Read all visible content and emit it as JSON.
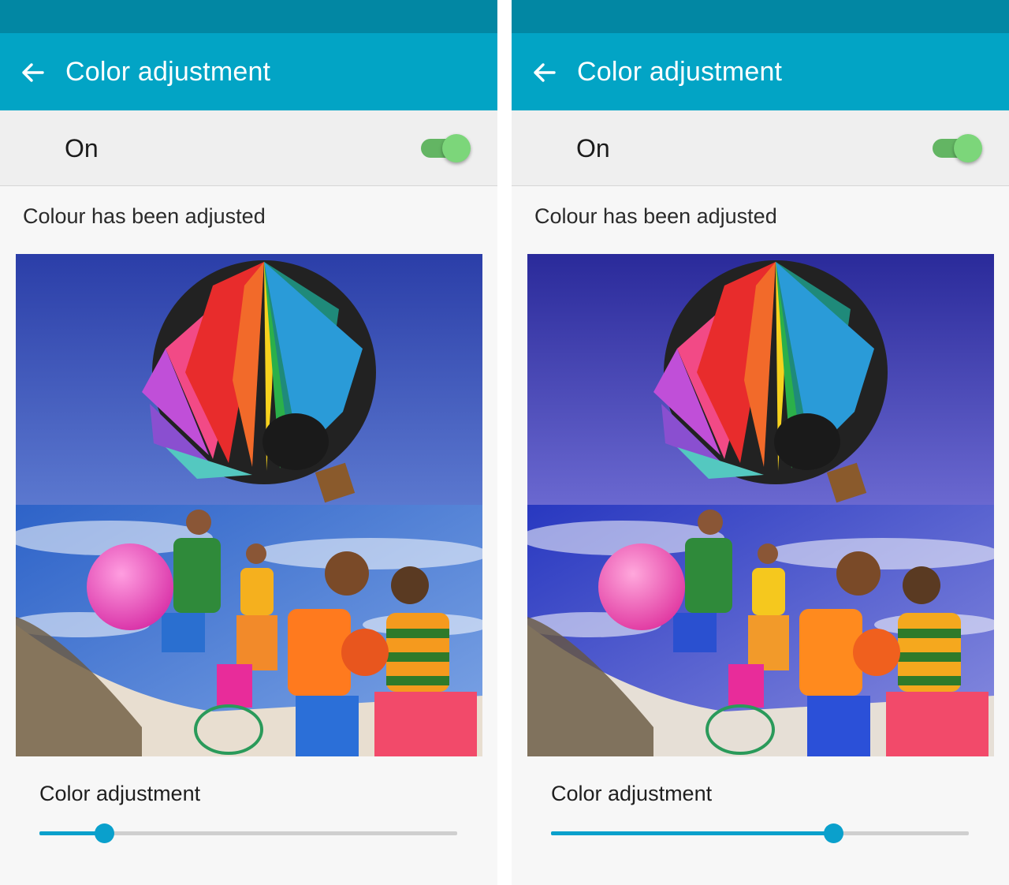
{
  "panels": [
    {
      "header": {
        "title": "Color adjustment"
      },
      "master_switch": {
        "label": "On",
        "on": true
      },
      "status_text": "Colour has been adjusted",
      "slider": {
        "label": "Color adjustment",
        "value": 0.155
      },
      "preview_tint": "#3b52c4"
    },
    {
      "header": {
        "title": "Color adjustment"
      },
      "master_switch": {
        "label": "On",
        "on": true
      },
      "status_text": "Colour has been adjusted",
      "slider": {
        "label": "Color adjustment",
        "value": 0.675
      },
      "preview_tint": "#4a3fc4"
    }
  ],
  "colors": {
    "status_bar": "#0287a3",
    "app_bar": "#02a4c5",
    "switch_on": "#7cd67a",
    "slider_accent": "#0aa0cc",
    "balloon_stripes": [
      "#f24a86",
      "#f26a2a",
      "#e82c2c",
      "#f7d21e",
      "#2bb04a",
      "#1f8a7a",
      "#2a9bd8",
      "#8a4fd0",
      "#c04fd8",
      "#54c8c0"
    ],
    "ball": "#e63fb0"
  },
  "icons": {
    "back": "arrow-left-icon"
  }
}
